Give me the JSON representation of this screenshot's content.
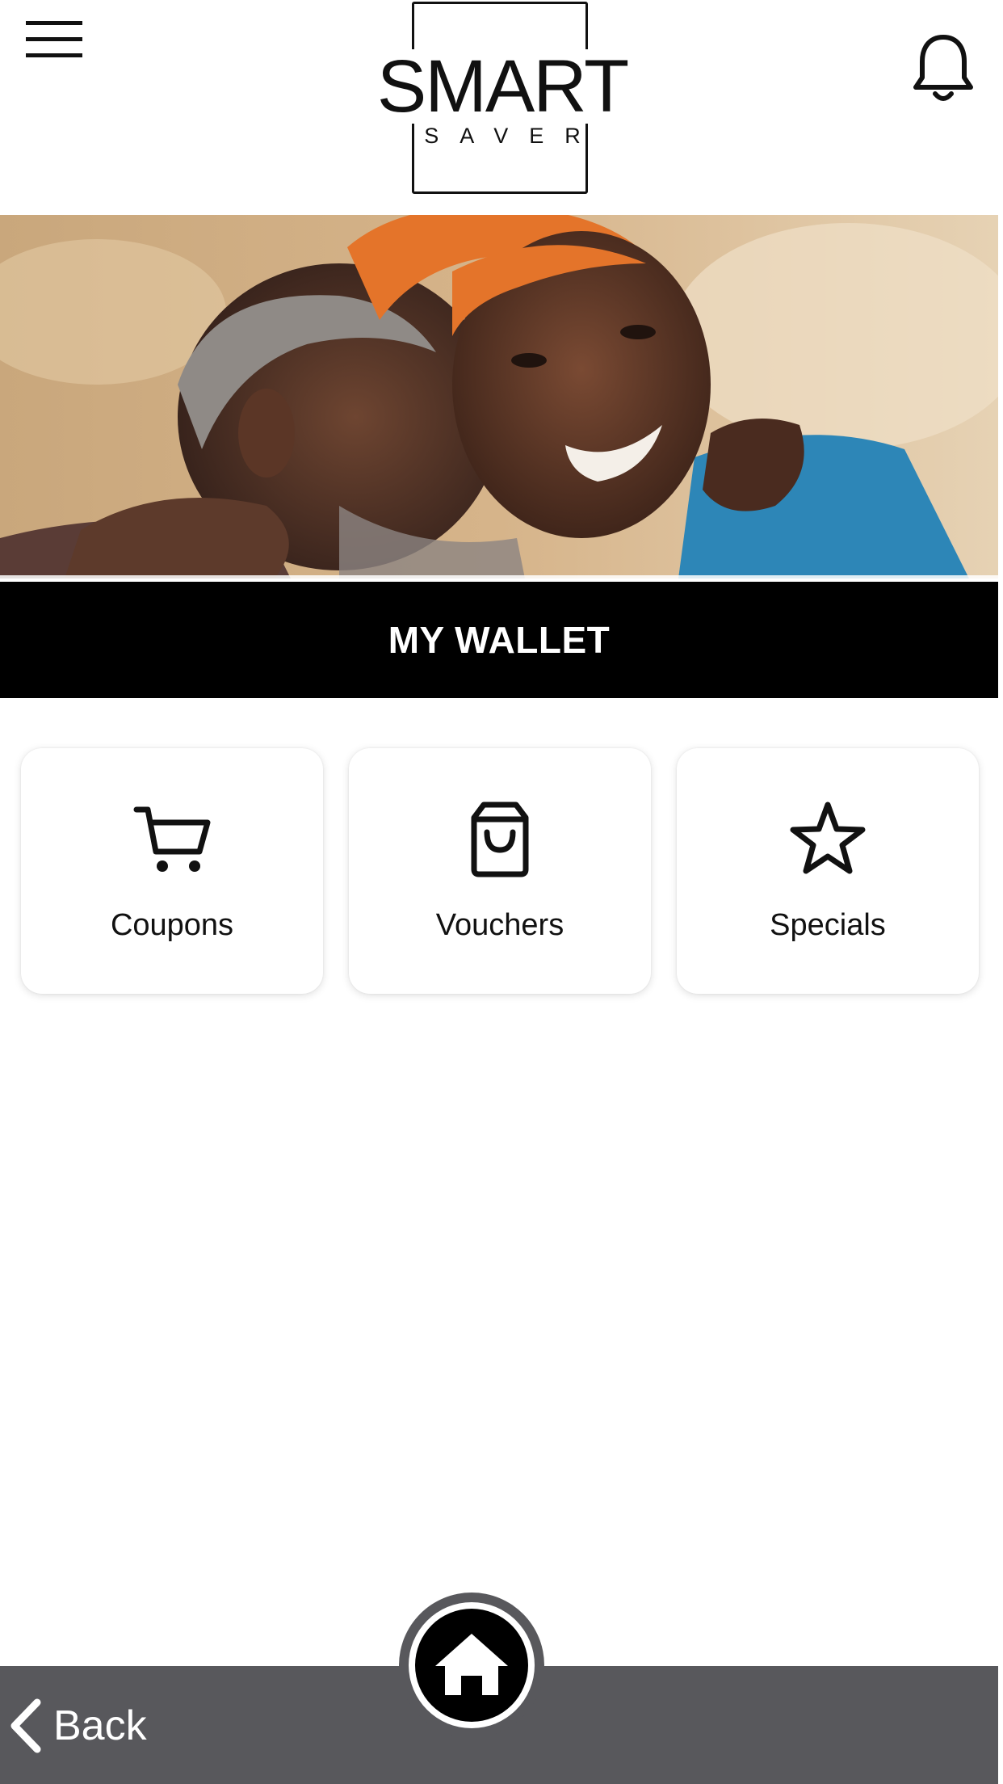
{
  "header": {
    "menu_icon": "hamburger-menu-icon",
    "bell_icon": "bell-icon",
    "logo": {
      "main": "SMART",
      "sub": "SAVER"
    }
  },
  "hero": {
    "image": "elderly-couple-hugging-photo"
  },
  "page_title": "MY WALLET",
  "tiles": [
    {
      "label": "Coupons",
      "icon": "shopping-cart-icon"
    },
    {
      "label": "Vouchers",
      "icon": "shopping-bag-icon"
    },
    {
      "label": "Specials",
      "icon": "star-icon"
    }
  ],
  "bottom_bar": {
    "back_label": "Back",
    "back_icon": "chevron-left-icon",
    "home_icon": "home-icon"
  },
  "colors": {
    "title_bar": "#000000",
    "bottom_bar": "#58585c",
    "text": "#111111"
  }
}
